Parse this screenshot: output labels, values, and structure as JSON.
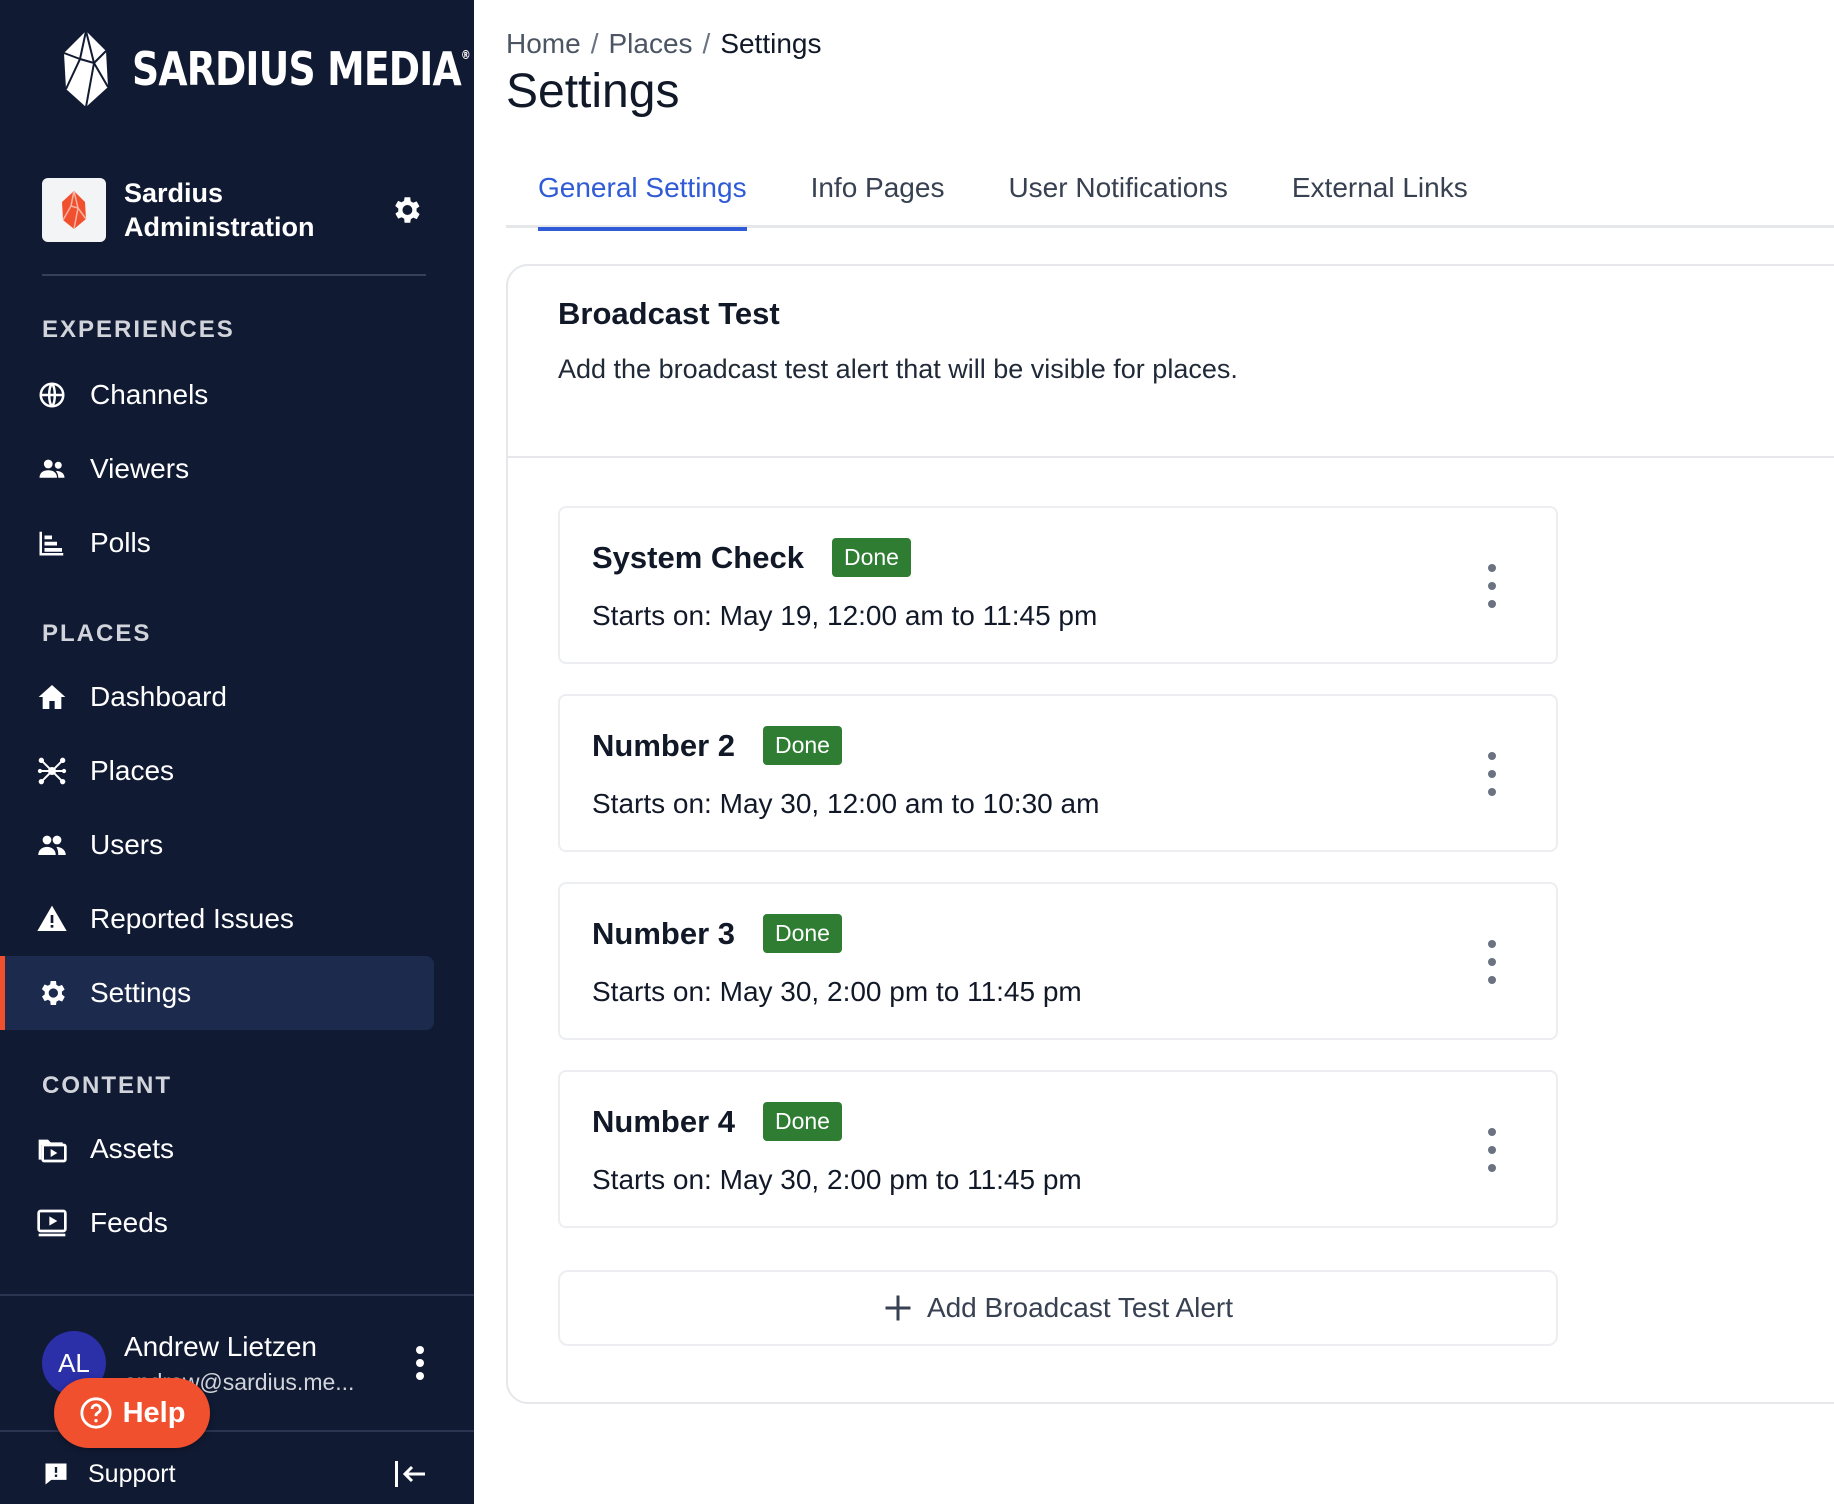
{
  "brand": {
    "name": "SARDIUS MEDIA",
    "registered": "®"
  },
  "org": {
    "name": "Sardius Administration"
  },
  "sections": {
    "experiences": "EXPERIENCES",
    "places": "PLACES",
    "content": "CONTENT"
  },
  "nav": {
    "channels": "Channels",
    "viewers": "Viewers",
    "polls": "Polls",
    "dashboard": "Dashboard",
    "places": "Places",
    "users": "Users",
    "reported_issues": "Reported Issues",
    "settings": "Settings",
    "assets": "Assets",
    "feeds": "Feeds"
  },
  "user": {
    "initials": "AL",
    "name": "Andrew Lietzen",
    "email": "andrew@sardius.me..."
  },
  "help": {
    "label": "Help"
  },
  "support": {
    "label": "Support"
  },
  "breadcrumb": {
    "home": "Home",
    "places": "Places",
    "current": "Settings",
    "separator": "/"
  },
  "page": {
    "title": "Settings"
  },
  "tabs": [
    {
      "label": "General Settings",
      "active": true
    },
    {
      "label": "Info Pages"
    },
    {
      "label": "User Notifications"
    },
    {
      "label": "External Links"
    }
  ],
  "panel": {
    "title": "Broadcast Test",
    "description": "Add the broadcast test alert that will be visible for places."
  },
  "alerts": [
    {
      "name": "System Check",
      "status": "Done",
      "time": "Starts on: May 19, 12:00 am to 11:45 pm"
    },
    {
      "name": "Number 2",
      "status": "Done",
      "time": "Starts on: May 30, 12:00 am to 10:30 am"
    },
    {
      "name": "Number 3",
      "status": "Done",
      "time": "Starts on: May 30, 2:00 pm to 11:45 pm"
    },
    {
      "name": "Number 4",
      "status": "Done",
      "time": "Starts on: May 30, 2:00 pm to 11:45 pm"
    }
  ],
  "add_button": {
    "label": "Add Broadcast Test Alert"
  },
  "colors": {
    "sidebar_bg": "#111a33",
    "accent_orange": "#f0502d",
    "tab_active": "#2f5bd6",
    "badge_done": "#2e7d32"
  }
}
